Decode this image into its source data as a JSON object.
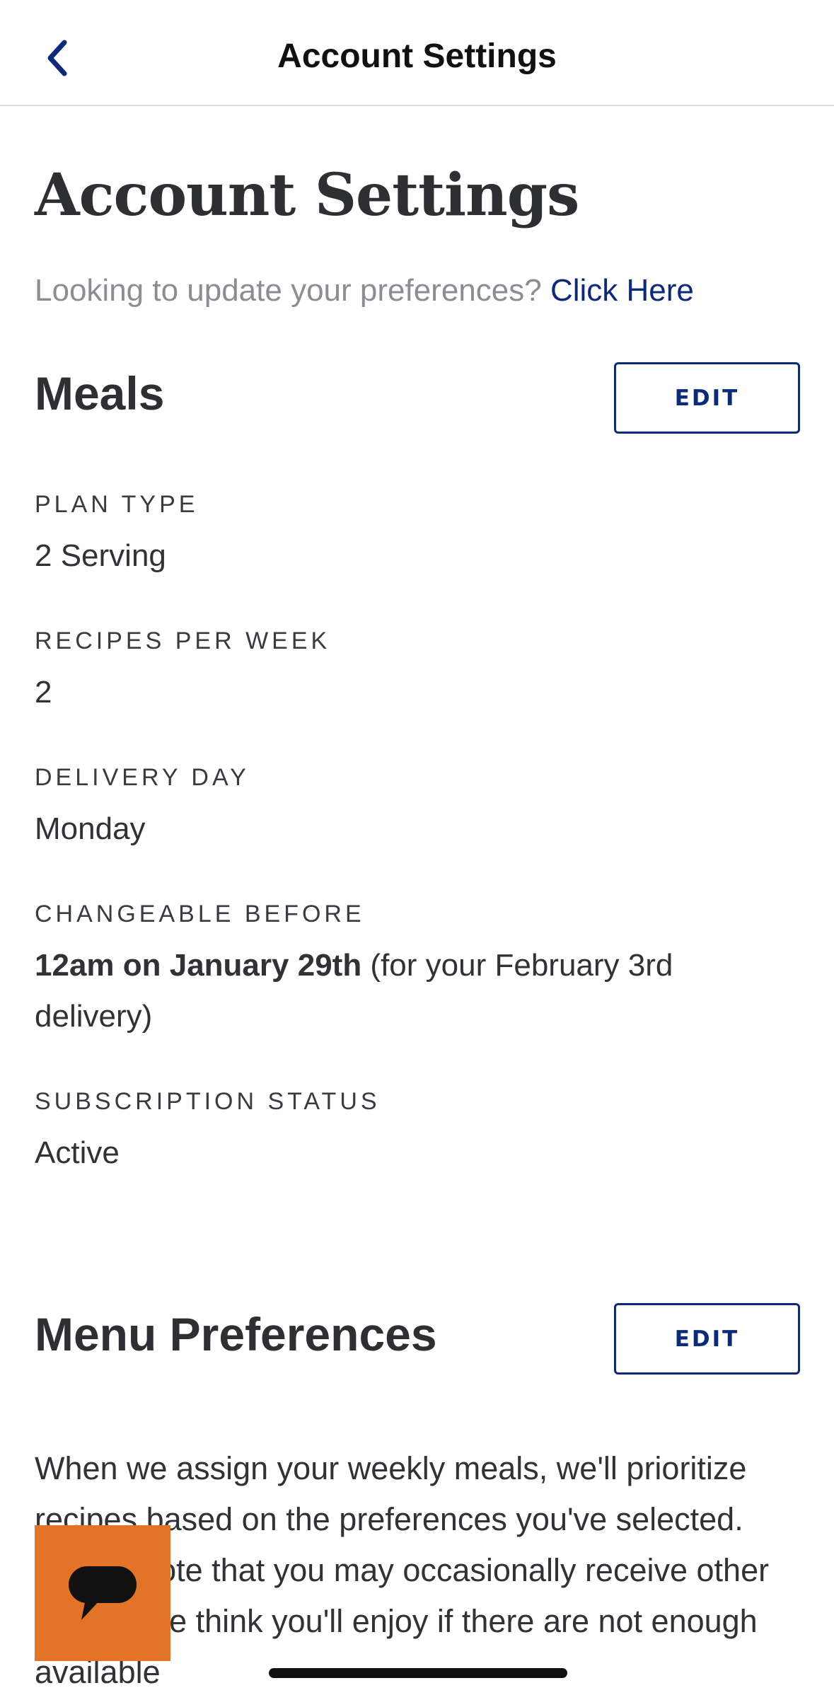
{
  "navbar": {
    "title": "Account Settings",
    "back_icon": "chevron-left-icon"
  },
  "page": {
    "title": "Account Settings",
    "preferences_prompt": "Looking to update your preferences?",
    "preferences_link": "Click Here"
  },
  "meals": {
    "title": "Meals",
    "edit_label": "EDIT",
    "fields": [
      {
        "label": "PLAN TYPE",
        "value": "2 Serving"
      },
      {
        "label": "RECIPES PER WEEK",
        "value": "2"
      },
      {
        "label": "DELIVERY DAY",
        "value": "Monday"
      },
      {
        "label": "CHANGEABLE BEFORE",
        "value_bold": "12am on January 29th",
        "value_rest": " (for your February 3rd delivery)"
      },
      {
        "label": "SUBSCRIPTION STATUS",
        "value": "Active"
      }
    ]
  },
  "menu_preferences": {
    "title": "Menu Preferences",
    "edit_label": "EDIT",
    "description": "When we assign your weekly meals, we'll prioritize recipes based on the preferences you've selected. Please note that you may occasionally receive other recipes we think you'll enjoy if there are not enough available"
  },
  "chat": {
    "icon": "chat-bubble-icon"
  },
  "colors": {
    "accent": "#0b2b7a",
    "chat": "#e37326",
    "text": "#303236",
    "muted": "#8b8d92"
  }
}
